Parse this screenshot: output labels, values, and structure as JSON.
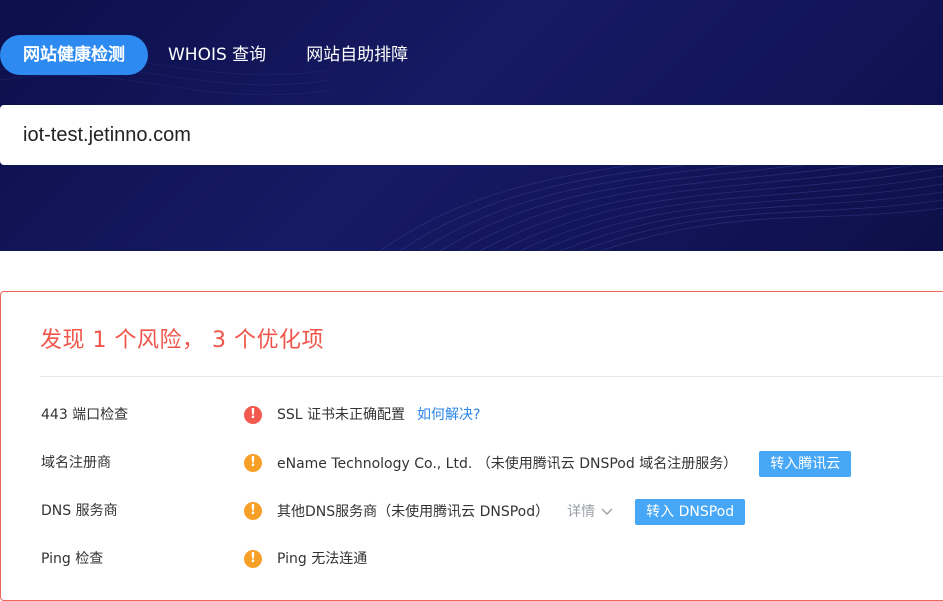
{
  "tabs": [
    {
      "label": "网站健康检测",
      "active": true
    },
    {
      "label": "WHOIS 查询",
      "active": false
    },
    {
      "label": "网站自助排障",
      "active": false
    }
  ],
  "search": {
    "value": "iot-test.jetinno.com"
  },
  "result": {
    "summary": "发现 1 个风险， 3 个优化项",
    "rows": [
      {
        "label": "443 端口检查",
        "icon": "error-icon",
        "icon_glyph": "!",
        "status": "risk",
        "value": "SSL 证书未正确配置",
        "link": "如何解决?"
      },
      {
        "label": "域名注册商",
        "icon": "warning-icon",
        "icon_glyph": "!",
        "status": "warning",
        "value": "eName Technology Co., Ltd. （未使用腾讯云 DNSPod 域名注册服务）",
        "button": "转入腾讯云"
      },
      {
        "label": "DNS 服务商",
        "icon": "warning-icon",
        "icon_glyph": "!",
        "status": "warning",
        "value": "其他DNS服务商（未使用腾讯云 DNSPod）",
        "detail": "详情",
        "button": "转入 DNSPod"
      },
      {
        "label": "Ping 检查",
        "icon": "warning-icon",
        "icon_glyph": "!",
        "status": "warning",
        "value": "Ping 无法连通"
      }
    ]
  },
  "colors": {
    "hero_bg": "#12155a",
    "tab_active": "#2c8af0",
    "risk": "#f25a50",
    "warning": "#f7a028",
    "summary_text": "#f0554a",
    "link": "#2a86e8",
    "button": "#47a7f7",
    "panel_border": "#f06459"
  }
}
